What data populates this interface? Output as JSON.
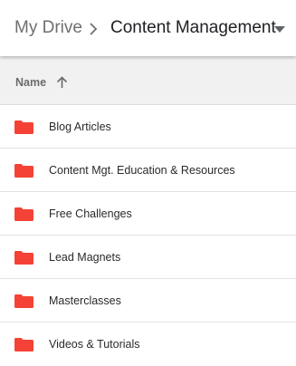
{
  "breadcrumb": {
    "root": "My Drive",
    "current": "Content Management"
  },
  "column": {
    "name_label": "Name",
    "sort_icon": "arrow-up-icon"
  },
  "folder_color": "#f44336",
  "folders": [
    {
      "label": "Blog Articles",
      "icon": "folder-icon"
    },
    {
      "label": "Content Mgt. Education & Resources",
      "icon": "folder-icon"
    },
    {
      "label": "Free Challenges",
      "icon": "folder-icon"
    },
    {
      "label": "Lead Magnets",
      "icon": "folder-icon"
    },
    {
      "label": "Masterclasses",
      "icon": "folder-icon"
    },
    {
      "label": "Videos & Tutorials",
      "icon": "folder-icon"
    }
  ]
}
